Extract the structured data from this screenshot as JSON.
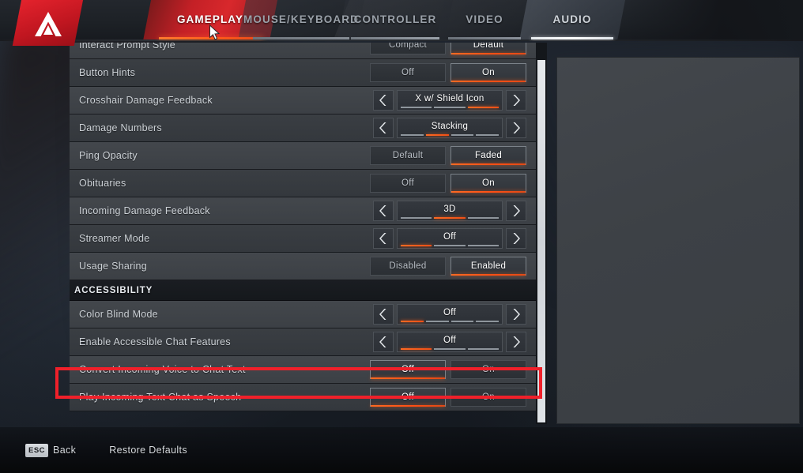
{
  "nav": {
    "logo_name": "apex-legends-logo",
    "tabs": [
      {
        "id": "gameplay",
        "label": "GAMEPLAY",
        "state": "active"
      },
      {
        "id": "mousekeyboard",
        "label": "MOUSE/KEYBOARD",
        "state": "inactive"
      },
      {
        "id": "controller",
        "label": "CONTROLLER",
        "state": "inactive"
      },
      {
        "id": "video",
        "label": "VIDEO",
        "state": "inactive"
      },
      {
        "id": "audio",
        "label": "AUDIO",
        "state": "hover"
      }
    ]
  },
  "settings": {
    "rows": [
      {
        "label": "Interact Prompt Style",
        "type": "pair",
        "options": [
          "Compact",
          "Default"
        ],
        "selected": "Default",
        "clipped": true
      },
      {
        "label": "Button Hints",
        "type": "pair",
        "options": [
          "Off",
          "On"
        ],
        "selected": "On"
      },
      {
        "label": "Crosshair Damage Feedback",
        "type": "cycle",
        "value": "X w/ Shield Icon",
        "segments": 3,
        "active_segment": 3
      },
      {
        "label": "Damage Numbers",
        "type": "cycle",
        "value": "Stacking",
        "segments": 4,
        "active_segment": 2
      },
      {
        "label": "Ping Opacity",
        "type": "pair",
        "options": [
          "Default",
          "Faded"
        ],
        "selected": "Faded"
      },
      {
        "label": "Obituaries",
        "type": "pair",
        "options": [
          "Off",
          "On"
        ],
        "selected": "On"
      },
      {
        "label": "Incoming Damage Feedback",
        "type": "cycle",
        "value": "3D",
        "segments": 3,
        "active_segment": 2
      },
      {
        "label": "Streamer Mode",
        "type": "cycle",
        "value": "Off",
        "segments": 3,
        "active_segment": 1
      },
      {
        "label": "Usage Sharing",
        "type": "pair",
        "options": [
          "Disabled",
          "Enabled"
        ],
        "selected": "Enabled"
      }
    ],
    "section_header": "ACCESSIBILITY",
    "accessibility_rows": [
      {
        "label": "Color Blind Mode",
        "type": "cycle",
        "value": "Off",
        "segments": 4,
        "active_segment": 1
      },
      {
        "label": "Enable Accessible Chat Features",
        "type": "cycle",
        "value": "Off",
        "segments": 3,
        "active_segment": 1
      },
      {
        "label": "Convert Incoming Voice to Chat Text",
        "type": "pair",
        "options": [
          "Off",
          "On"
        ],
        "selected": "Off",
        "highlighted": true
      },
      {
        "label": "Play Incoming Text Chat as Speech",
        "type": "pair",
        "options": [
          "Off",
          "On"
        ],
        "selected": "Off"
      }
    ]
  },
  "description_panel": {
    "text": ""
  },
  "footer": {
    "back_key": "ESC",
    "back_label": "Back",
    "restore_defaults_label": "Restore Defaults"
  },
  "annotation": {
    "target": "Convert Incoming Voice to Chat Text",
    "color": "#f0202a"
  },
  "colors": {
    "accent_orange": "#ff5f19",
    "tab_active_red": "#c42026",
    "annotation_red": "#f0202a",
    "row_light": "#3f4449",
    "row_dark": "#373b40",
    "text_primary": "#ffffff",
    "text_secondary": "#cdd2d7"
  }
}
